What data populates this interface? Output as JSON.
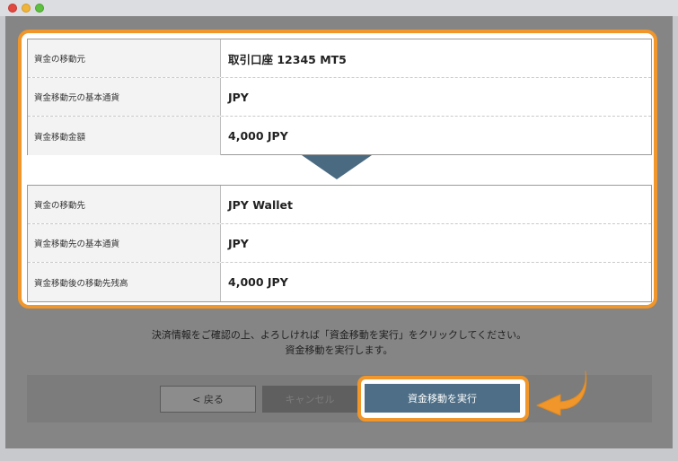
{
  "window": {
    "controls": [
      "close",
      "minimize",
      "zoom"
    ]
  },
  "source": {
    "rows": [
      {
        "label": "資金の移動元",
        "value": "取引口座 12345 MT5"
      },
      {
        "label": "資金移動元の基本通貨",
        "value": "JPY"
      },
      {
        "label": "資金移動金額",
        "value": "4,000 JPY"
      }
    ]
  },
  "destination": {
    "rows": [
      {
        "label": "資金の移動先",
        "value": "JPY Wallet"
      },
      {
        "label": "資金移動先の基本通貨",
        "value": "JPY"
      },
      {
        "label": "資金移動後の移動先残高",
        "value": "4,000 JPY"
      }
    ]
  },
  "instructions": {
    "line1": "決済情報をご確認の上、よろしければ「資金移動を実行」をクリックしてください。",
    "line2": "資金移動を実行します。"
  },
  "buttons": {
    "back": "< 戻る",
    "cancel": "キャンセル",
    "execute": "資金移動を実行"
  },
  "colors": {
    "highlight": "#f0962a",
    "primary": "#4d6e86",
    "arrow": "#4a6a82"
  },
  "icons": {
    "transfer_arrow": "triangle-down-icon",
    "pointer": "curved-arrow-left-icon"
  }
}
